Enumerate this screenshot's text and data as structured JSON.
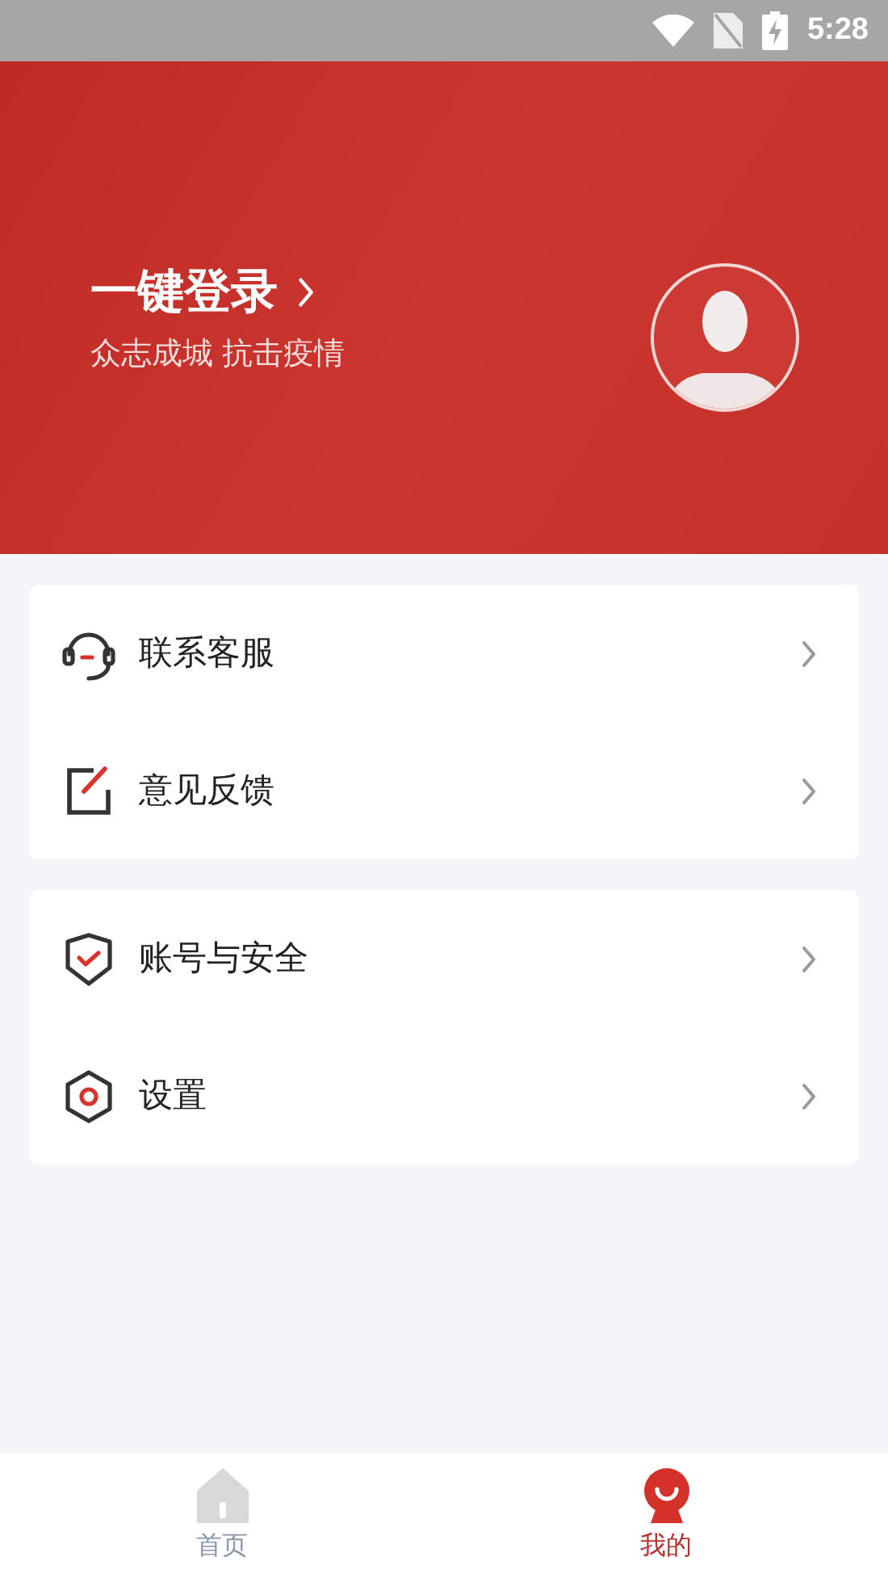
{
  "status_bar": {
    "time": "5:28"
  },
  "header": {
    "title": "一键登录",
    "subtitle": "众志成城 抗击疫情"
  },
  "menu_groups": [
    [
      {
        "kind": "headset",
        "label": "联系客服"
      },
      {
        "kind": "edit",
        "label": "意见反馈"
      }
    ],
    [
      {
        "kind": "shield",
        "label": "账号与安全"
      },
      {
        "kind": "settings",
        "label": "设置"
      }
    ]
  ],
  "tabs": [
    {
      "kind": "home",
      "label": "首页",
      "selected": false
    },
    {
      "kind": "mine",
      "label": "我的",
      "selected": true
    }
  ]
}
